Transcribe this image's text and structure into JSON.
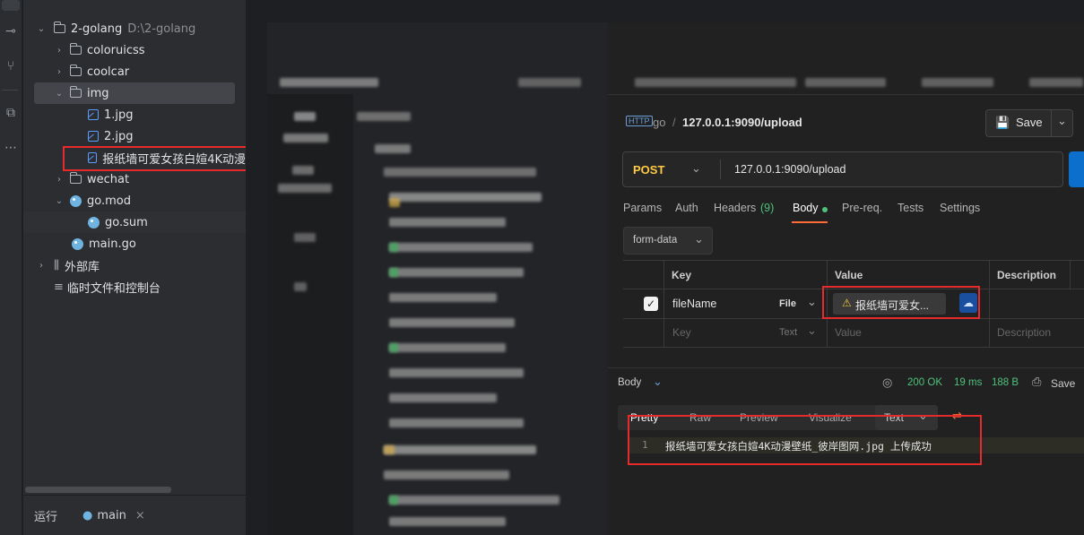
{
  "project_tree": {
    "root": {
      "label": "2-golang",
      "path": "D:\\2-golang"
    },
    "items": [
      {
        "label": "coloruicss",
        "type": "folder",
        "expanded": false
      },
      {
        "label": "coolcar",
        "type": "folder",
        "expanded": false
      },
      {
        "label": "img",
        "type": "folder",
        "expanded": true,
        "selected": true
      },
      {
        "label": "1.jpg",
        "type": "image"
      },
      {
        "label": "2.jpg",
        "type": "image"
      },
      {
        "label": "报纸墙可爱女孩白媗4K动漫",
        "type": "image",
        "highlighted": true
      },
      {
        "label": "wechat",
        "type": "folder",
        "expanded": false
      },
      {
        "label": "go.mod",
        "type": "gomod",
        "expanded": true
      },
      {
        "label": "go.sum",
        "type": "gosum"
      },
      {
        "label": "main.go",
        "type": "go"
      }
    ],
    "external_libs": "外部库",
    "scratches": "临时文件和控制台"
  },
  "run_bar": {
    "label": "运行",
    "config": "main",
    "close": "×"
  },
  "postman": {
    "breadcrumb": {
      "collection": "go",
      "separator": "/",
      "request": "127.0.0.1:9090/upload"
    },
    "save_label": "Save",
    "method": "POST",
    "url": "127.0.0.1:9090/upload",
    "tabs": [
      {
        "label": "Params"
      },
      {
        "label": "Auth"
      },
      {
        "label": "Headers",
        "count": "(9)"
      },
      {
        "label": "Body",
        "active": true
      },
      {
        "label": "Pre-req."
      },
      {
        "label": "Tests"
      },
      {
        "label": "Settings"
      }
    ],
    "body_mode": "form-data",
    "table": {
      "headers": [
        "Key",
        "Value",
        "Description"
      ],
      "rows": [
        {
          "checked": true,
          "key": "fileName",
          "type": "File",
          "value": "报纸墙可爱女...",
          "description": ""
        },
        {
          "checked": false,
          "key_placeholder": "Key",
          "type": "Text",
          "value_placeholder": "Value",
          "description_placeholder": "Description"
        }
      ]
    },
    "response": {
      "label": "Body",
      "status": "200 OK",
      "time": "19 ms",
      "size": "188 B",
      "save_label": "Save",
      "view_tabs": [
        "Pretty",
        "Raw",
        "Preview",
        "Visualize"
      ],
      "format": "Text",
      "line_number": "1",
      "line_text": "报纸墙可爱女孩白媗4K动漫壁纸_彼岸图网.jpg 上传成功"
    },
    "colors": {
      "method": "#ffcb45",
      "status_ok": "#4ec27c",
      "accent": "#ff6c37",
      "send": "#0c6fcc"
    }
  }
}
